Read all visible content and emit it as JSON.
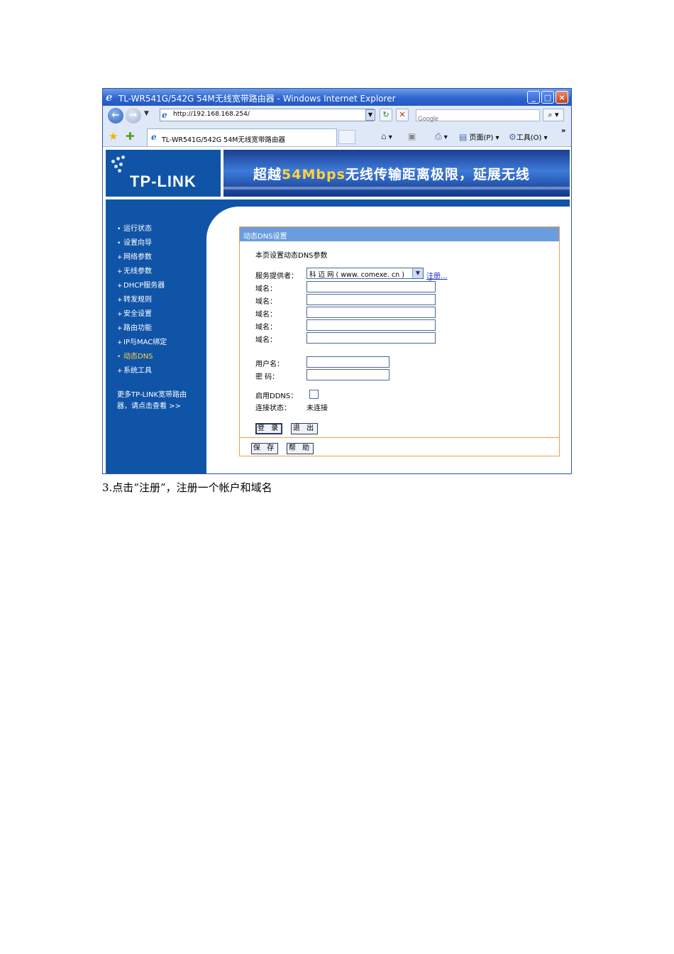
{
  "window": {
    "title": "TL-WR541G/542G 54M无线宽带路由器 - Windows Internet Explorer",
    "controls": {
      "minimize": "_",
      "maximize": "□",
      "close": "×"
    }
  },
  "address_bar": {
    "url": "http://192.168.168.254/",
    "search_placeholder": "Google"
  },
  "tab_bar": {
    "tab_title": "TL-WR541G/542G 54M无线宽带路由器",
    "page_menu": "页面(P)",
    "tools_menu": "工具(O)",
    "more": "»"
  },
  "header": {
    "logo": "TP-LINK",
    "banner_prefix": "超越",
    "banner_highlight": "54Mbps",
    "banner_suffix": "无线传输距离极限，延展无线"
  },
  "sidebar": {
    "items": [
      {
        "label": "运行状态",
        "bullet": "•"
      },
      {
        "label": "设置向导",
        "bullet": "•"
      },
      {
        "label": "网络参数",
        "bullet": "+"
      },
      {
        "label": "无线参数",
        "bullet": "+"
      },
      {
        "label": "DHCP服务器",
        "bullet": "+"
      },
      {
        "label": "转发规则",
        "bullet": "+"
      },
      {
        "label": "安全设置",
        "bullet": "+"
      },
      {
        "label": "路由功能",
        "bullet": "+"
      },
      {
        "label": "IP与MAC绑定",
        "bullet": "+"
      },
      {
        "label": "动态DNS",
        "bullet": "•",
        "active": true
      },
      {
        "label": "系统工具",
        "bullet": "+"
      }
    ],
    "more_text": "更多TP-LINK宽带路由器，请点击查看 >>"
  },
  "panel": {
    "title": "动态DNS设置",
    "description": "本页设置动态DNS参数",
    "provider_label": "服务提供者：",
    "provider_value": "科 迈 网 ( www. comexe. cn )",
    "register_link": "注册...",
    "domain_label": "域名：",
    "domain_values": [
      "",
      "",
      "",
      "",
      ""
    ],
    "username_label": "用户名：",
    "username_value": "",
    "password_label": "密  码：",
    "password_value": "",
    "enable_label": "启用DDNS：",
    "enable_checked": false,
    "status_label": "连接状态：",
    "status_value": "未连接",
    "login_button": "登 录",
    "logout_button": "退 出",
    "save_button": "保 存",
    "help_button": "帮 助"
  },
  "caption": "3.点击“注册”，注册一个帐户和域名"
}
